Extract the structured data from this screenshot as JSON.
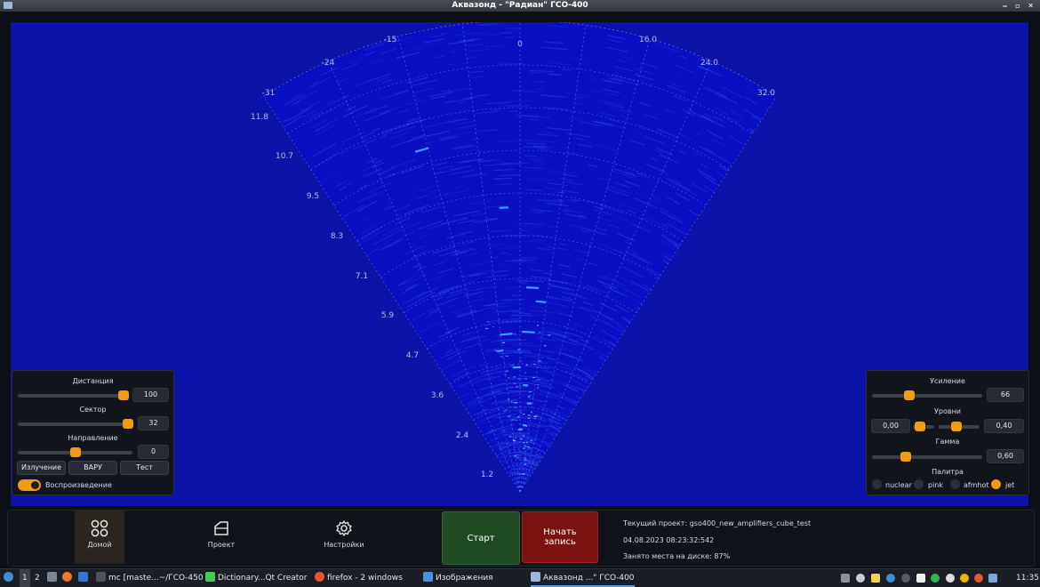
{
  "window": {
    "title": "Аквазонд  - \"Радиан\" ГСО-400",
    "controls": "‒ ▫ ✕"
  },
  "sonar": {
    "angle_labels": [
      "-31",
      "-24",
      "-15",
      "0",
      "16.0",
      "24.0",
      "32.0"
    ],
    "range_labels": [
      "11.8",
      "10.7",
      "9.5",
      "8.3",
      "7.1",
      "5.9",
      "4.7",
      "3.6",
      "2.4",
      "1.2"
    ],
    "background_color": "#0d13a8",
    "echo_color": "#3fa0ff"
  },
  "left_panel": {
    "distance": {
      "label": "Дистанция",
      "value": "100",
      "level": 0.93
    },
    "sector": {
      "label": "Сектор",
      "value": "32",
      "level": 0.96
    },
    "direction": {
      "label": "Направление",
      "value": "0",
      "level": 0.5
    },
    "buttons": [
      "Излучение",
      "ВАРУ",
      "Тест"
    ],
    "playback": {
      "label": "Воспроизведение",
      "on": true
    }
  },
  "right_panel": {
    "gain": {
      "label": "Усиление",
      "value": "66",
      "level": 0.33
    },
    "levels": {
      "label": "Уровни",
      "min": "0,00",
      "max": "0,40"
    },
    "gamma": {
      "label": "Гамма",
      "value": "0,60",
      "level": 0.3
    },
    "palette": {
      "label": "Палитра",
      "options": [
        "nuclear",
        "pink",
        "afmhot",
        "jet"
      ],
      "selected": "jet"
    }
  },
  "nav": {
    "home": "Домой",
    "project": "Проект",
    "settings": "Настройки"
  },
  "actions": {
    "start": "Старт",
    "record": "Начать запись",
    "start_color": "#1f4a22",
    "record_color": "#7a1212"
  },
  "info": {
    "project": "Текущий проект: gso400_new_amplifiers_cube_test",
    "datetime": "04.08.2023  08:23:32:542",
    "disk": "Занято места на диске: 87%"
  },
  "taskbar": {
    "workspaces": [
      "1",
      "2"
    ],
    "apps": [
      "mc [maste...~/ГСО-450",
      "Dictionary...Qt Creator",
      "firefox - 2 windows",
      "Изображения",
      "Аквазонд ...\" ГСО-400"
    ],
    "clock": "11:35"
  }
}
